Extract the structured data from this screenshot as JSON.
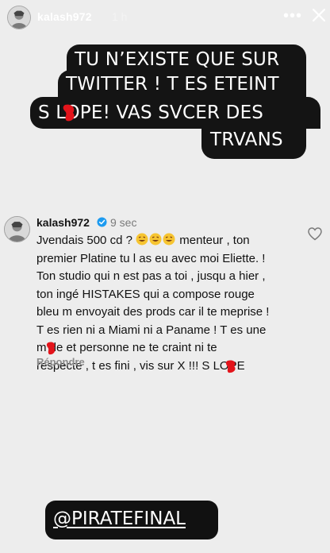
{
  "story": {
    "username": "kalash972",
    "time": "1 h",
    "menu_icon": "more-icon",
    "close_icon": "close-icon"
  },
  "caption": {
    "lines": [
      "TU N’EXISTE QUE SUR",
      "TWITTER ! T ES ETEINT",
      "S  LOPE! VAS SVCER DES",
      "TRVANS"
    ]
  },
  "comment": {
    "username": "kalash972",
    "time": "9 sec",
    "lines": [
      "Jvendais 500 cd ?",
      "menteur , ton",
      "premier Platine tu l as eu avec moi Eliette. !",
      "Ton studio qui n est pas a toi , jusqu a hier ,",
      "ton ingé HISTAKES qui a compose rouge",
      "bleu m envoyait des prods car il te meprise !",
      "T es rien ni a Miami ni a Paname ! T es une",
      "m  de et personne ne te craint ni te",
      "respecte , t es fini , vis sur X !!! S  LOPE"
    ],
    "reply_label": "Répondre",
    "like_icon": "heart-icon"
  },
  "mention": {
    "text": "@PIRATEFINAL"
  },
  "colors": {
    "background": "#ededed",
    "caption_bg": "#141414",
    "redaction": "#e3141b",
    "verified": "#1d9bf0"
  }
}
